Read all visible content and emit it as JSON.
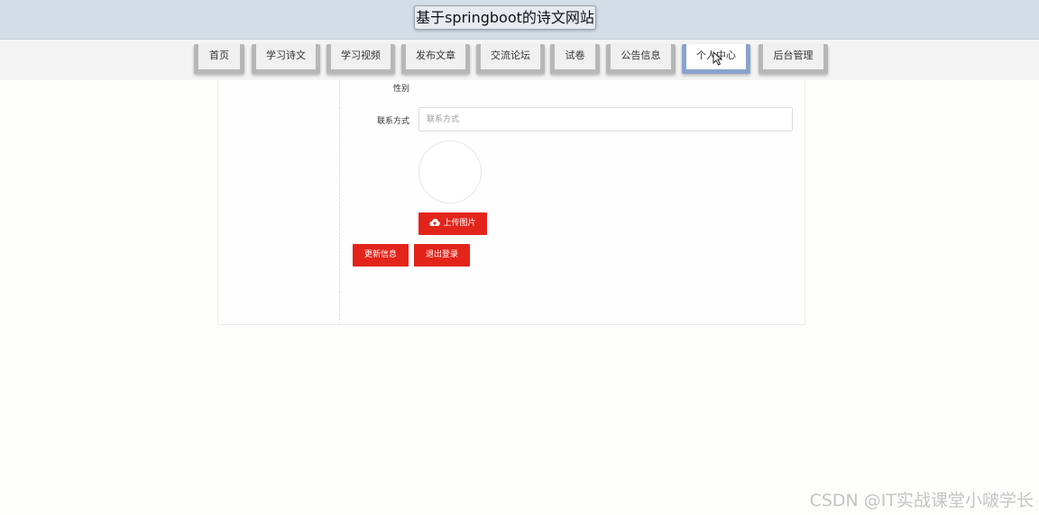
{
  "header": {
    "site_title": "基于springboot的诗文网站"
  },
  "nav": {
    "items": [
      {
        "label": "首页"
      },
      {
        "label": "学习诗文"
      },
      {
        "label": "学习视频"
      },
      {
        "label": "发布文章"
      },
      {
        "label": "交流论坛"
      },
      {
        "label": "试卷"
      },
      {
        "label": "公告信息"
      },
      {
        "label": "个人中心"
      },
      {
        "label": "后台管理"
      }
    ],
    "active": "个人中心"
  },
  "form": {
    "gender_label": "性别",
    "contact_label": "联系方式",
    "contact_value": "",
    "contact_placeholder": "联系方式",
    "upload_label": "上传图片",
    "update_label": "更新信息",
    "logout_label": "退出登录"
  },
  "watermark": "CSDN @IT实战课堂小啵学长",
  "colors": {
    "header_bg": "#d3dde7",
    "primary_red": "#e3241b",
    "active_tab_border": "#87a4cc"
  },
  "icons": {
    "upload": "cloud-upload-icon",
    "cursor": "mouse-pointer-icon"
  }
}
